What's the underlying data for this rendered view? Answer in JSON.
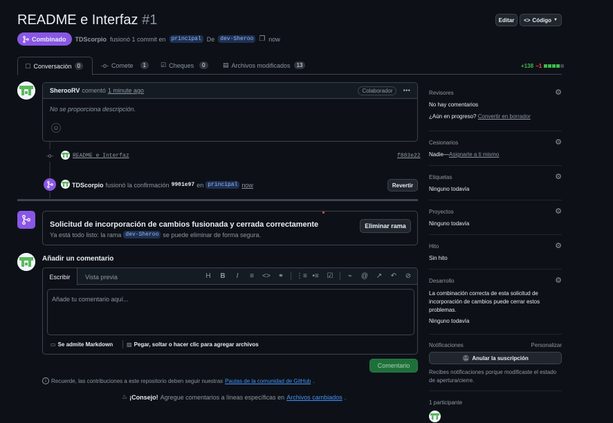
{
  "header": {
    "title": "README e Interfaz",
    "number": "#1",
    "edit_label": "Editar",
    "code_label": "Código",
    "status_label": "Combinado",
    "author": "TDScorpio",
    "merged_text": "fusionó 1 commit en",
    "base_branch": "principal",
    "from_text": "De",
    "head_branch": "dev-Sheroo",
    "time": "now"
  },
  "tabs": [
    {
      "label": "Conversación",
      "count": "0"
    },
    {
      "label": "Comete",
      "count": "1"
    },
    {
      "label": "Cheques",
      "count": "0"
    },
    {
      "label": "Archivos modificados",
      "count": "13"
    }
  ],
  "diffstat": {
    "added": "+138",
    "removed": "−1"
  },
  "comment": {
    "author": "SherooRV",
    "action": "comentó",
    "time": "1 minute ago",
    "badge": "Colaborador",
    "body": "No se proporciona descripción."
  },
  "commit_event": {
    "message": "README e Interfaz",
    "sha": "f883e22"
  },
  "merge_event": {
    "author": "TDScorpio",
    "text": "fusionó la confirmación",
    "sha": "9901e97",
    "in_text": "en",
    "branch": "principal",
    "time": "now",
    "revert_label": "Revertir"
  },
  "merged_box": {
    "title": "Solicitud de incorporación de cambios fusionada y cerrada correctamente",
    "sub_before": "Ya está todo listo: la rama",
    "branch": "dev-Sheroo",
    "sub_after": "se puede eliminar de forma segura.",
    "delete_label": "Eliminar rama"
  },
  "new_comment": {
    "heading": "Añadir un comentario",
    "tab_write": "Escribir",
    "tab_preview": "Vista previa",
    "placeholder": "Añade tu comentario aquí...",
    "markdown_note": "Se admite Markdown",
    "attach_note": "Pegar, soltar o hacer clic para agregar archivos",
    "submit_label": "Comentario"
  },
  "footer": {
    "reminder_before": "Recuerde, las contribuciones a este repositorio deben seguir nuestras",
    "reminder_link": "Pautas de la comunidad de GitHub",
    "reminder_after": ".",
    "tip_label": "¡Consejo!",
    "tip_text": "Agregue comentarios a líneas específicas en",
    "tip_link": "Archivos cambiados",
    "tip_after": "."
  },
  "sidebar": {
    "reviewers": {
      "title": "Revisores",
      "value": "No hay comentarios",
      "q": "¿Aún en progreso?",
      "link": "Convertir en borrador"
    },
    "assignees": {
      "title": "Cesionarios",
      "value": "Nadie—",
      "link": "Asignarte a ti mismo"
    },
    "labels": {
      "title": "Etiquetas",
      "value": "Ninguno todavía"
    },
    "projects": {
      "title": "Proyectos",
      "value": "Ninguno todavía"
    },
    "milestone": {
      "title": "Hito",
      "value": "Sin hito"
    },
    "development": {
      "title": "Desarrollo",
      "text": "La combinación correcta de esta solicitud de incorporación de cambios puede cerrar estos problemas.",
      "value": "Ninguno todavía"
    },
    "notifications": {
      "title": "Notificaciones",
      "customize": "Personalizar",
      "button": "Anular la suscripción",
      "note": "Recibes notificaciones porque modificaste el estado de apertura/cierre."
    },
    "participants": {
      "title": "1 participante"
    }
  },
  "colors": {
    "merged": "#8957e5",
    "green": "#238636",
    "link": "#4493f8",
    "bg": "#0d1117"
  }
}
